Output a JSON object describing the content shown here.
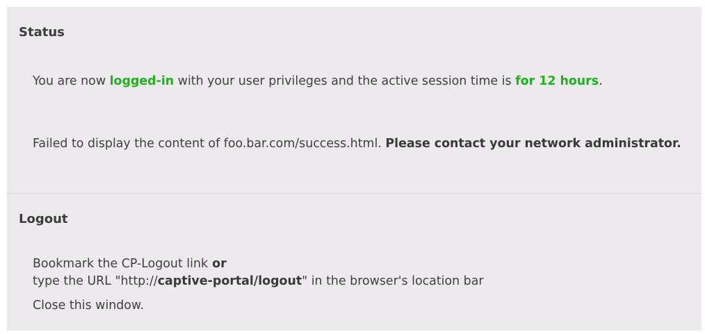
{
  "status": {
    "heading": "Status",
    "login_msg": {
      "pre": "You are now ",
      "state": "logged-in",
      "mid": " with your user privileges and the active session time is ",
      "duration": "for 12 hours",
      "post": "."
    },
    "error_msg": {
      "text": "Failed to display the content of foo.bar.com/success.html. ",
      "emphasis": "Please contact your network administrator."
    }
  },
  "logout": {
    "heading": "Logout",
    "bookmark": {
      "pre": "Bookmark the ",
      "link": "CP-Logout link",
      "conj": " or"
    },
    "url_line": {
      "pre": "type the URL \"http://",
      "url": "captive-portal/logout",
      "post": "\" in the browser's location bar"
    },
    "close_link": "Close this window."
  },
  "colors": {
    "panel_bg": "#eceaec",
    "accent_green": "#1fb11f",
    "text": "#404040"
  }
}
